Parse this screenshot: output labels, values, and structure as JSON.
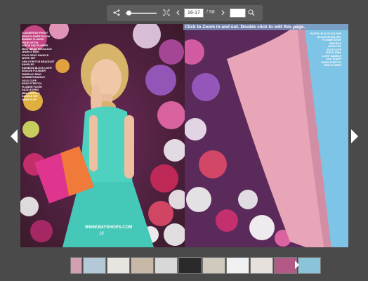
{
  "toolbar": {
    "share_icon": "share-icon",
    "zoom_out_icon": "zoom-out-icon",
    "fullscreen_icon": "fullscreen-icon",
    "prev_icon": "chevron-left-icon",
    "next_icon": "chevron-right-icon",
    "search_icon": "search-icon",
    "zoom_level": 0.1,
    "current_pages": "16-17",
    "total_pages": "/ 58",
    "search_value": ""
  },
  "book": {
    "hint": "Click to Zoom in and out. Double click to edit this page.",
    "left_credits": [
      "CLASSIFIEDS FRONT",
      "SEAN FLOWER SALON",
      "ENAMEL FLOWER",
      "PRIJE DETOX",
      "SEEDS AND FLOWER",
      "MULTI BEAD NECKLACE",
      "JEWELS RING",
      "GOLD DEWY BANGLE",
      "WHITE SET",
      "GEM STRETCH BRACELET",
      "BANGLES",
      "RAINBOW BLOCK LIGHT",
      "SEASON FOUNDER",
      "EMERALD RING",
      "SHIMMER BANGLE",
      "GOLD CUFF",
      "BEAD STRETCH",
      "FLOWER FILTER",
      "DAZZLE RING",
      "MINI STRETCH",
      "BANGLE SET",
      "DEWY CUFF"
    ],
    "right_credits": [
      "PASTEL BLOCK COLOUR",
      "BLOCK DETAIL SET",
      "FLOWER DROP",
      "MINI BAG",
      "SATIN TOP",
      "GOLD CUFF",
      "PEARL RING",
      "LIGHT BANGLE",
      "SILK SCARF",
      "BEAD STRETCH",
      "PINK FLOWER"
    ],
    "site_url": "WWW.BAYSHOPS.COM",
    "page_number": "16"
  },
  "navigation": {
    "prev_icon": "chevron-left-icon",
    "next_icon": "chevron-right-icon"
  },
  "thumbnails": [
    {
      "name": "thumb-page-1",
      "bg": "#d4a0b0"
    },
    {
      "name": "thumb-page-2",
      "bg": "#b5c8d8"
    },
    {
      "name": "thumb-page-3",
      "bg": "#e8e4df"
    },
    {
      "name": "thumb-page-4",
      "bg": "#c7b8a8"
    },
    {
      "name": "thumb-page-5",
      "bg": "#d8d8d8"
    },
    {
      "name": "thumb-page-6",
      "bg": "#2a2a2a"
    },
    {
      "name": "thumb-page-7",
      "bg": "#cfcabd"
    },
    {
      "name": "thumb-page-8",
      "bg": "#f0f0f0"
    },
    {
      "name": "thumb-page-9",
      "bg": "#e6e1dc"
    },
    {
      "name": "thumb-page-10",
      "bg": "#b25a85"
    },
    {
      "name": "thumb-page-11",
      "bg": "#8bc4d8"
    }
  ],
  "colors": {
    "background": "#4a4a4a",
    "toolbar": "#5e5e5e",
    "dress": "#4fd1c0",
    "bag_pink": "#e0358f",
    "bag_orange": "#f07a3a",
    "curl_pink": "#e8a5b8",
    "right_blue": "#7ec4e6"
  }
}
